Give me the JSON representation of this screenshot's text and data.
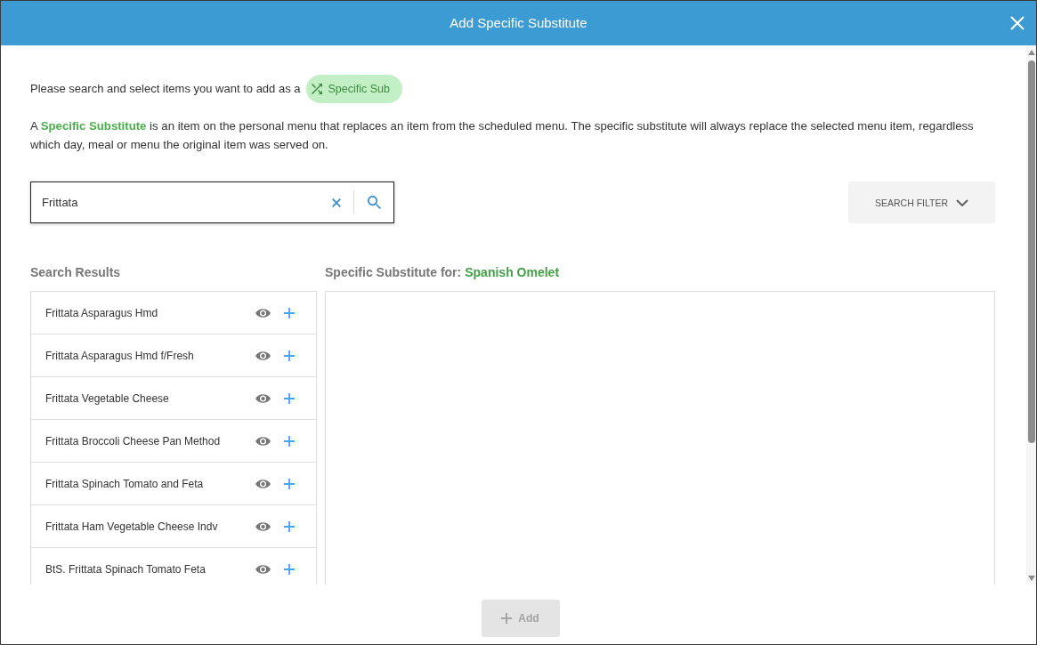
{
  "dialog": {
    "title": "Add Specific Substitute"
  },
  "intro": {
    "text": "Please search and select items you want to add as a",
    "tag": {
      "label": "Specific Sub"
    }
  },
  "description": "A **Specific Substitute** is an item on the personal menu that replaces an item from the scheduled menu. The specific substitute will always replace the selected menu item, regardless which day, meal or menu the original item was served on.",
  "search": {
    "value": "Frittata"
  },
  "search_filter": {
    "label": "SEARCH FILTER"
  },
  "results": {
    "heading": "Search Results",
    "items": [
      {
        "name": "Frittata Asparagus Hmd"
      },
      {
        "name": "Frittata Asparagus Hmd f/Fresh"
      },
      {
        "name": "Frittata Vegetable Cheese"
      },
      {
        "name": "Frittata Broccoli Cheese Pan Method"
      },
      {
        "name": "Frittata Spinach Tomato and Feta"
      },
      {
        "name": "Frittata Ham Vegetable Cheese Indv"
      },
      {
        "name": "BtS. Frittata Spinach Tomato Feta"
      }
    ]
  },
  "substitute": {
    "heading": "Specific Substitute for:",
    "target": "Spanish Omelet"
  },
  "add_button": {
    "label": "Add",
    "disabled": true
  }
}
